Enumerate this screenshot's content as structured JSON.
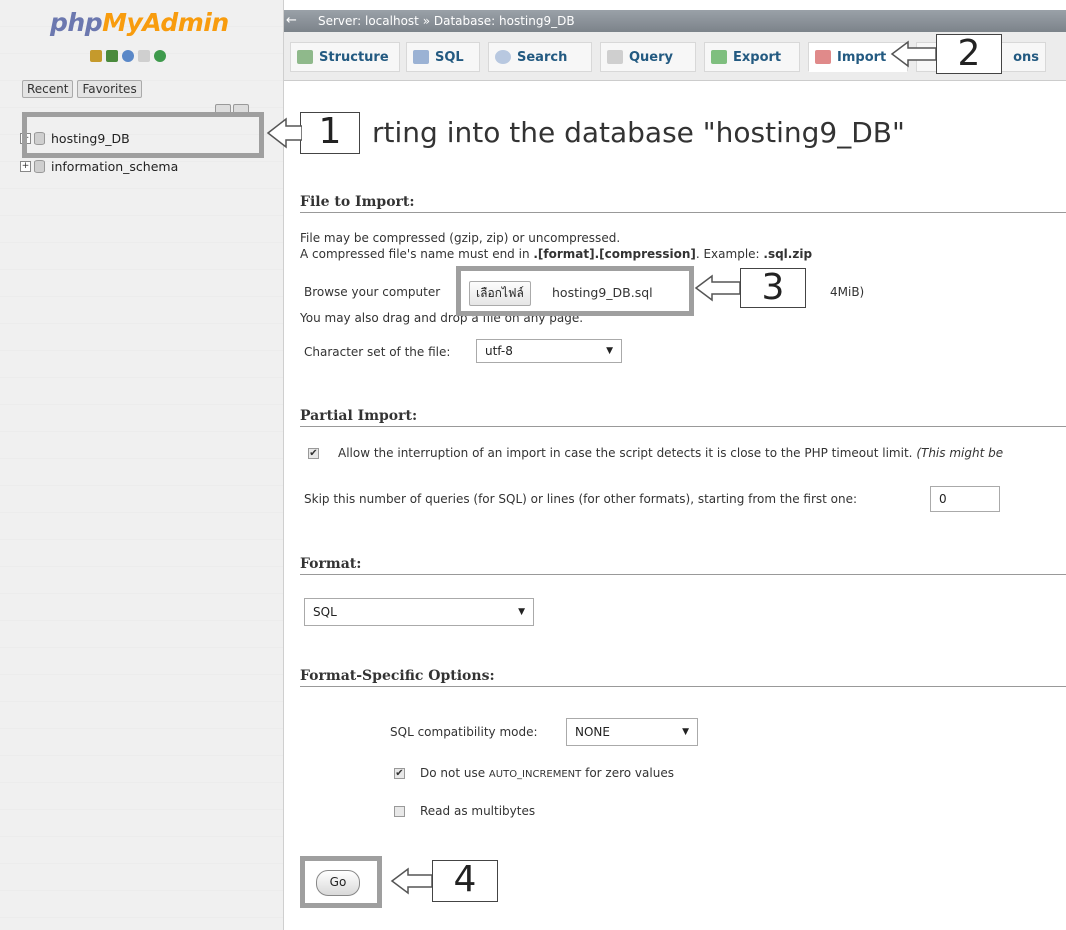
{
  "nav": {
    "logo_php": "php",
    "logo_my": "My",
    "logo_admin": "Admin",
    "tabs": [
      "Recent",
      "Favorites"
    ],
    "databases": [
      "hosting9_DB",
      "information_schema"
    ]
  },
  "breadcrumb": {
    "server": "Server: localhost",
    "separator": "»",
    "database": "Database: hosting9_DB"
  },
  "tabs": [
    "Structure",
    "SQL",
    "Search",
    "Query",
    "Export",
    "Import",
    "ons"
  ],
  "page": {
    "title": "rting into the database \"hosting9_DB\""
  },
  "file_section": {
    "title": "File to Import:",
    "line1": "File may be compressed (gzip, zip) or uncompressed.",
    "line2_prefix": "A compressed file's name must end in ",
    "line2_format": ".[format].[compression]",
    "line2_example": ". Example: ",
    "line2_ext": ".sql.zip",
    "browse_label": "Browse your computer",
    "choose_button": "เลือกไฟล์",
    "file_name": "hosting9_DB.sql",
    "max_size": "4MiB)",
    "drag_note": "You may also drag and drop a file on any page.",
    "charset_label": "Character set of the file:",
    "charset_value": "utf-8"
  },
  "partial_section": {
    "title": "Partial Import:",
    "allow_text": "Allow the interruption of an import in case the script detects it is close to the PHP timeout limit.",
    "allow_note": "(This might be",
    "skip_label": "Skip this number of queries (for SQL) or lines (for other formats), starting from the first one:",
    "skip_value": "0"
  },
  "format_section": {
    "title": "Format:",
    "value": "SQL"
  },
  "options_section": {
    "title": "Format-Specific Options:",
    "compat_label": "SQL compatibility mode:",
    "compat_value": "NONE",
    "no_auto_prefix": "Do not use ",
    "no_auto_code": "AUTO_INCREMENT",
    "no_auto_suffix": " for zero values",
    "multibyte_label": "Read as multibytes"
  },
  "go_button": "Go",
  "annotations": [
    "1",
    "2",
    "3",
    "4"
  ],
  "colors": {
    "logo_php": "#6c78af",
    "logo_myadmin": "#f89c0e",
    "tab_text": "#235a81",
    "annotation_border": "#9f9f9f"
  }
}
